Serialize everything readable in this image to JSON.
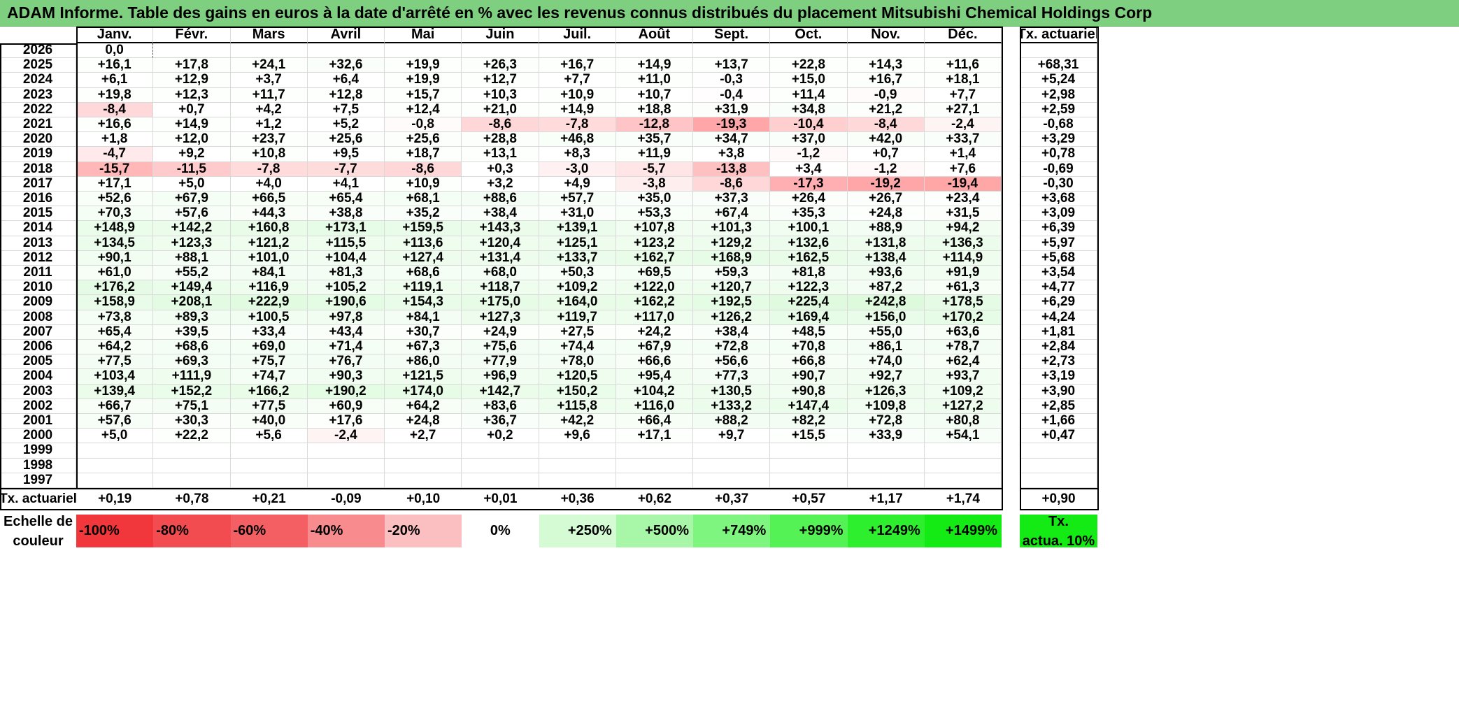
{
  "title": "ADAM Informe. Table des gains en euros à la date d'arrêté en % avec les revenus connus distribués du placement Mitsubishi Chemical Holdings Corp",
  "months": [
    "Janv.",
    "Févr.",
    "Mars",
    "Avril",
    "Mai",
    "Juin",
    "Juil.",
    "Août",
    "Sept.",
    "Oct.",
    "Nov.",
    "Déc."
  ],
  "tx_header": "Tx. actuariel",
  "rows": [
    {
      "year": "2026",
      "values": [
        "0,0",
        "",
        "",
        "",
        "",
        "",
        "",
        "",
        "",
        "",
        "",
        ""
      ],
      "tx": ""
    },
    {
      "year": "2025",
      "values": [
        "+16,1",
        "+17,8",
        "+24,1",
        "+32,6",
        "+19,9",
        "+26,3",
        "+16,7",
        "+14,9",
        "+13,7",
        "+22,8",
        "+14,3",
        "+11,6"
      ],
      "tx": "+68,31"
    },
    {
      "year": "2024",
      "values": [
        "+6,1",
        "+12,9",
        "+3,7",
        "+6,4",
        "+19,9",
        "+12,7",
        "+7,7",
        "+11,0",
        "-0,3",
        "+15,0",
        "+16,7",
        "+18,1"
      ],
      "tx": "+5,24"
    },
    {
      "year": "2023",
      "values": [
        "+19,8",
        "+12,3",
        "+11,7",
        "+12,8",
        "+15,7",
        "+10,3",
        "+10,9",
        "+10,7",
        "-0,4",
        "+11,4",
        "-0,9",
        "+7,7"
      ],
      "tx": "+2,98"
    },
    {
      "year": "2022",
      "values": [
        "-8,4",
        "+0,7",
        "+4,2",
        "+7,5",
        "+12,4",
        "+21,0",
        "+14,9",
        "+18,8",
        "+31,9",
        "+34,8",
        "+21,2",
        "+27,1"
      ],
      "tx": "+2,59"
    },
    {
      "year": "2021",
      "values": [
        "+16,6",
        "+14,9",
        "+1,2",
        "+5,2",
        "-0,8",
        "-8,6",
        "-7,8",
        "-12,8",
        "-19,3",
        "-10,4",
        "-8,4",
        "-2,4"
      ],
      "tx": "-0,68"
    },
    {
      "year": "2020",
      "values": [
        "+1,8",
        "+12,0",
        "+23,7",
        "+25,6",
        "+25,6",
        "+28,8",
        "+46,8",
        "+35,7",
        "+34,7",
        "+37,0",
        "+42,0",
        "+33,7"
      ],
      "tx": "+3,29"
    },
    {
      "year": "2019",
      "values": [
        "-4,7",
        "+9,2",
        "+10,8",
        "+9,5",
        "+18,7",
        "+13,1",
        "+8,3",
        "+11,9",
        "+3,8",
        "-1,2",
        "+0,7",
        "+1,4"
      ],
      "tx": "+0,78"
    },
    {
      "year": "2018",
      "values": [
        "-15,7",
        "-11,5",
        "-7,8",
        "-7,7",
        "-8,6",
        "+0,3",
        "-3,0",
        "-5,7",
        "-13,8",
        "+3,4",
        "-1,2",
        "+7,6"
      ],
      "tx": "-0,69"
    },
    {
      "year": "2017",
      "values": [
        "+17,1",
        "+5,0",
        "+4,0",
        "+4,1",
        "+10,9",
        "+3,2",
        "+4,9",
        "-3,8",
        "-8,6",
        "-17,3",
        "-19,2",
        "-19,4"
      ],
      "tx": "-0,30"
    },
    {
      "year": "2016",
      "values": [
        "+52,6",
        "+67,9",
        "+66,5",
        "+65,4",
        "+68,1",
        "+88,6",
        "+57,7",
        "+35,0",
        "+37,3",
        "+26,4",
        "+26,7",
        "+23,4"
      ],
      "tx": "+3,68"
    },
    {
      "year": "2015",
      "values": [
        "+70,3",
        "+57,6",
        "+44,3",
        "+38,8",
        "+35,2",
        "+38,4",
        "+31,0",
        "+53,3",
        "+67,4",
        "+35,3",
        "+24,8",
        "+31,5"
      ],
      "tx": "+3,09"
    },
    {
      "year": "2014",
      "values": [
        "+148,9",
        "+142,2",
        "+160,8",
        "+173,1",
        "+159,5",
        "+143,3",
        "+139,1",
        "+107,8",
        "+101,3",
        "+100,1",
        "+88,9",
        "+94,2"
      ],
      "tx": "+6,39"
    },
    {
      "year": "2013",
      "values": [
        "+134,5",
        "+123,3",
        "+121,2",
        "+115,5",
        "+113,6",
        "+120,4",
        "+125,1",
        "+123,2",
        "+129,2",
        "+132,6",
        "+131,8",
        "+136,3"
      ],
      "tx": "+5,97"
    },
    {
      "year": "2012",
      "values": [
        "+90,1",
        "+88,1",
        "+101,0",
        "+104,4",
        "+127,4",
        "+131,4",
        "+133,7",
        "+162,7",
        "+168,9",
        "+162,5",
        "+138,4",
        "+114,9"
      ],
      "tx": "+5,68"
    },
    {
      "year": "2011",
      "values": [
        "+61,0",
        "+55,2",
        "+84,1",
        "+81,3",
        "+68,6",
        "+68,0",
        "+50,3",
        "+69,5",
        "+59,3",
        "+81,8",
        "+93,6",
        "+91,9"
      ],
      "tx": "+3,54"
    },
    {
      "year": "2010",
      "values": [
        "+176,2",
        "+149,4",
        "+116,9",
        "+105,2",
        "+119,1",
        "+118,7",
        "+109,2",
        "+122,0",
        "+120,7",
        "+122,3",
        "+87,2",
        "+61,3"
      ],
      "tx": "+4,77"
    },
    {
      "year": "2009",
      "values": [
        "+158,9",
        "+208,1",
        "+222,9",
        "+190,6",
        "+154,3",
        "+175,0",
        "+164,0",
        "+162,2",
        "+192,5",
        "+225,4",
        "+242,8",
        "+178,5"
      ],
      "tx": "+6,29"
    },
    {
      "year": "2008",
      "values": [
        "+73,8",
        "+89,3",
        "+100,5",
        "+97,8",
        "+84,1",
        "+127,3",
        "+119,7",
        "+117,0",
        "+126,2",
        "+169,4",
        "+156,0",
        "+170,2"
      ],
      "tx": "+4,24"
    },
    {
      "year": "2007",
      "values": [
        "+65,4",
        "+39,5",
        "+33,4",
        "+43,4",
        "+30,7",
        "+24,9",
        "+27,5",
        "+24,2",
        "+38,4",
        "+48,5",
        "+55,0",
        "+63,6"
      ],
      "tx": "+1,81"
    },
    {
      "year": "2006",
      "values": [
        "+64,2",
        "+68,6",
        "+69,0",
        "+71,4",
        "+67,3",
        "+75,6",
        "+74,4",
        "+67,9",
        "+72,8",
        "+70,8",
        "+86,1",
        "+78,7"
      ],
      "tx": "+2,84"
    },
    {
      "year": "2005",
      "values": [
        "+77,5",
        "+69,3",
        "+75,7",
        "+76,7",
        "+86,0",
        "+77,9",
        "+78,0",
        "+66,6",
        "+56,6",
        "+66,8",
        "+74,0",
        "+62,4"
      ],
      "tx": "+2,73"
    },
    {
      "year": "2004",
      "values": [
        "+103,4",
        "+111,9",
        "+74,7",
        "+90,3",
        "+121,5",
        "+96,9",
        "+120,5",
        "+95,4",
        "+77,3",
        "+90,7",
        "+92,7",
        "+93,7"
      ],
      "tx": "+3,19"
    },
    {
      "year": "2003",
      "values": [
        "+139,4",
        "+152,2",
        "+166,2",
        "+190,2",
        "+174,0",
        "+142,7",
        "+150,2",
        "+104,2",
        "+130,5",
        "+90,8",
        "+126,3",
        "+109,2"
      ],
      "tx": "+3,90"
    },
    {
      "year": "2002",
      "values": [
        "+66,7",
        "+75,1",
        "+77,5",
        "+60,9",
        "+64,2",
        "+83,6",
        "+115,8",
        "+116,0",
        "+133,2",
        "+147,4",
        "+109,8",
        "+127,2"
      ],
      "tx": "+2,85"
    },
    {
      "year": "2001",
      "values": [
        "+57,6",
        "+30,3",
        "+40,0",
        "+17,6",
        "+24,8",
        "+36,7",
        "+42,2",
        "+66,4",
        "+88,2",
        "+82,2",
        "+72,8",
        "+80,8"
      ],
      "tx": "+1,66"
    },
    {
      "year": "2000",
      "values": [
        "+5,0",
        "+22,2",
        "+5,6",
        "-2,4",
        "+2,7",
        "+0,2",
        "+9,6",
        "+17,1",
        "+9,7",
        "+15,5",
        "+33,9",
        "+54,1"
      ],
      "tx": "+0,47"
    },
    {
      "year": "1999",
      "values": [
        "",
        "",
        "",
        "",
        "",
        "",
        "",
        "",
        "",
        "",
        "",
        ""
      ],
      "tx": ""
    },
    {
      "year": "1998",
      "values": [
        "",
        "",
        "",
        "",
        "",
        "",
        "",
        "",
        "",
        "",
        "",
        ""
      ],
      "tx": ""
    },
    {
      "year": "1997",
      "values": [
        "",
        "",
        "",
        "",
        "",
        "",
        "",
        "",
        "",
        "",
        "",
        ""
      ],
      "tx": ""
    }
  ],
  "tx_row": {
    "label": "Tx. actuariel",
    "values": [
      "+0,19",
      "+0,78",
      "+0,21",
      "-0,09",
      "+0,10",
      "+0,01",
      "+0,36",
      "+0,62",
      "+0,37",
      "+0,57",
      "+1,17",
      "+1,74"
    ],
    "total": "+0,90"
  },
  "scale": {
    "label_line1": "Echelle de",
    "label_line2": "couleur",
    "items": [
      {
        "text": "-100%",
        "color": "#f1373c"
      },
      {
        "text": "-80%",
        "color": "#f24b50"
      },
      {
        "text": "-60%",
        "color": "#f45f63"
      },
      {
        "text": "-40%",
        "color": "#f78b8e"
      },
      {
        "text": "-20%",
        "color": "#fbbfc1"
      },
      {
        "text": "0%",
        "color": "#ffffff"
      },
      {
        "text": "+250%",
        "color": "#d4fbd4"
      },
      {
        "text": "+500%",
        "color": "#a8f7a8"
      },
      {
        "text": "+749%",
        "color": "#7ef57e"
      },
      {
        "text": "+999%",
        "color": "#54f254"
      },
      {
        "text": "+1249%",
        "color": "#2eef2e"
      },
      {
        "text": "+1499%",
        "color": "#14ea14"
      }
    ],
    "tx_label_line1": "Tx.",
    "tx_label_line2": "actua. 10%",
    "tx_color": "#14ea14"
  }
}
